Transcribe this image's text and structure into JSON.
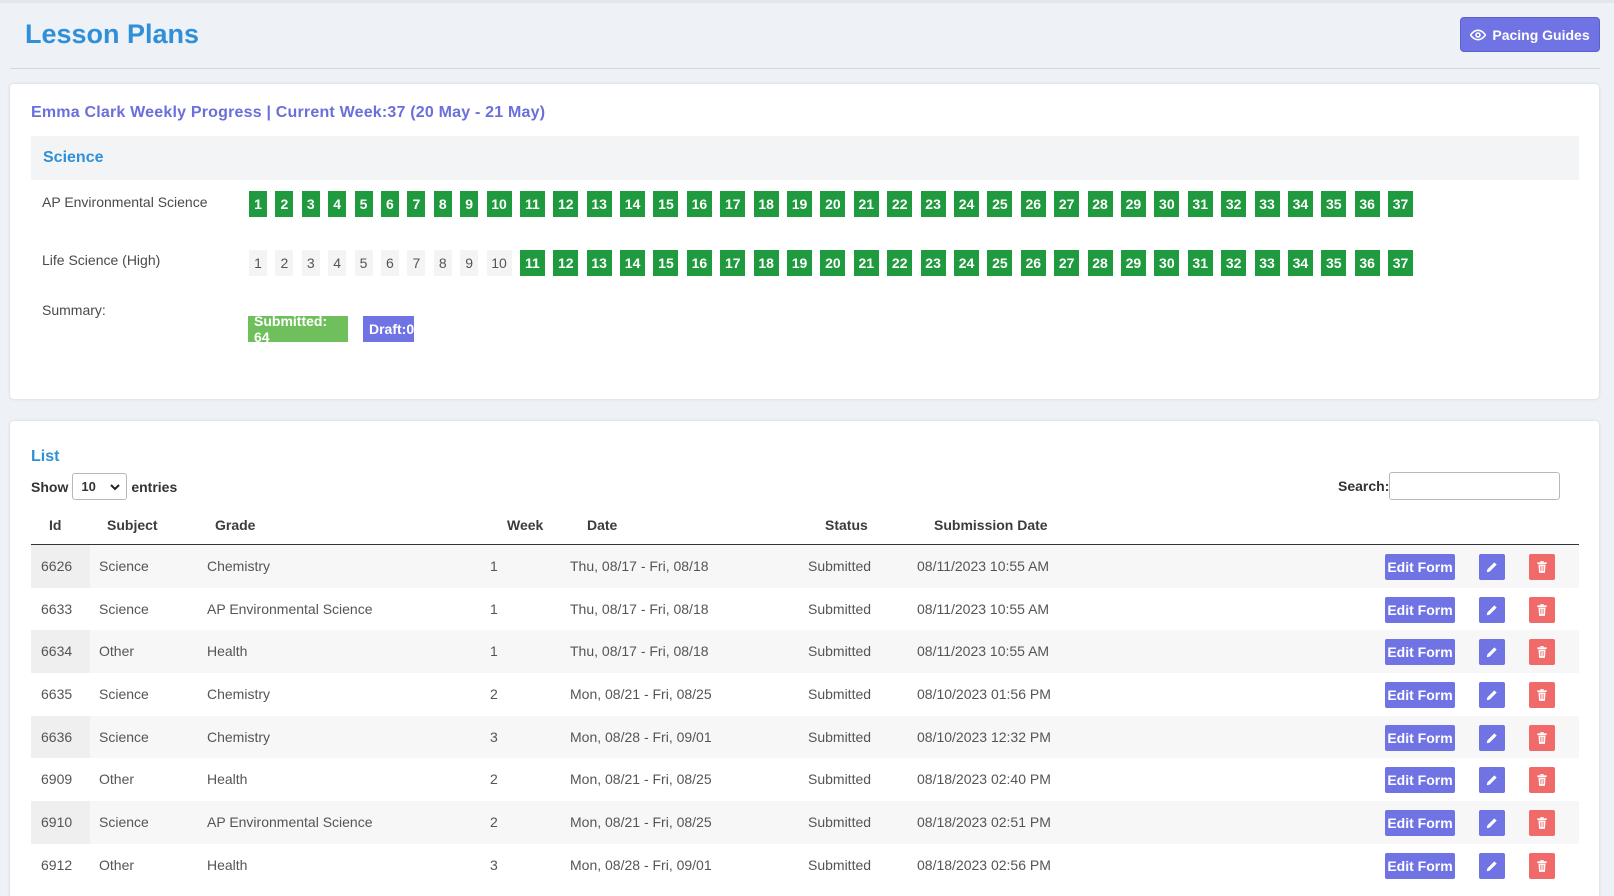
{
  "header": {
    "title": "Lesson Plans",
    "pacing_button": "Pacing Guides"
  },
  "progress": {
    "title": "Emma Clark Weekly Progress | Current Week:37 (20 May - 21 May)",
    "section": "Science",
    "rows": [
      {
        "label": "AP Environmental Science",
        "weeks": [
          "1",
          "2",
          "3",
          "4",
          "5",
          "6",
          "7",
          "8",
          "9",
          "10",
          "11",
          "12",
          "13",
          "14",
          "15",
          "16",
          "17",
          "18",
          "19",
          "20",
          "21",
          "22",
          "23",
          "24",
          "25",
          "26",
          "27",
          "28",
          "29",
          "30",
          "31",
          "32",
          "33",
          "34",
          "35",
          "36",
          "37"
        ],
        "submitted_from": 1
      },
      {
        "label": "Life Science (High)",
        "weeks": [
          "1",
          "2",
          "3",
          "4",
          "5",
          "6",
          "7",
          "8",
          "9",
          "10",
          "11",
          "12",
          "13",
          "14",
          "15",
          "16",
          "17",
          "18",
          "19",
          "20",
          "21",
          "22",
          "23",
          "24",
          "25",
          "26",
          "27",
          "28",
          "29",
          "30",
          "31",
          "32",
          "33",
          "34",
          "35",
          "36",
          "37"
        ],
        "submitted_from": 11
      }
    ],
    "summary_label": "Summary:",
    "submitted_badge": "Submitted: 64",
    "draft_badge": "Draft:0",
    "colors": {
      "submitted": "#1f9a3e",
      "summary_submitted": "#6fc05d",
      "draft": "#6f73e4"
    }
  },
  "list": {
    "title": "List",
    "show_label": "Show",
    "entries_value": "10",
    "entries_label": "entries",
    "search_label": "Search:",
    "search_value": "",
    "columns": [
      "Id",
      "Subject",
      "Grade",
      "Week",
      "Date",
      "Status",
      "Submission Date"
    ],
    "edit_form_label": "Edit Form",
    "rows": [
      {
        "id": "6626",
        "subject": "Science",
        "grade": "Chemistry",
        "week": "1",
        "date": "Thu, 08/17 - Fri, 08/18",
        "status": "Submitted",
        "submission": "08/11/2023 10:55 AM"
      },
      {
        "id": "6633",
        "subject": "Science",
        "grade": "AP Environmental Science",
        "week": "1",
        "date": "Thu, 08/17 - Fri, 08/18",
        "status": "Submitted",
        "submission": "08/11/2023 10:55 AM"
      },
      {
        "id": "6634",
        "subject": "Other",
        "grade": "Health",
        "week": "1",
        "date": "Thu, 08/17 - Fri, 08/18",
        "status": "Submitted",
        "submission": "08/11/2023 10:55 AM"
      },
      {
        "id": "6635",
        "subject": "Science",
        "grade": "Chemistry",
        "week": "2",
        "date": "Mon, 08/21 - Fri, 08/25",
        "status": "Submitted",
        "submission": "08/10/2023 01:56 PM"
      },
      {
        "id": "6636",
        "subject": "Science",
        "grade": "Chemistry",
        "week": "3",
        "date": "Mon, 08/28 - Fri, 09/01",
        "status": "Submitted",
        "submission": "08/10/2023 12:32 PM"
      },
      {
        "id": "6909",
        "subject": "Other",
        "grade": "Health",
        "week": "2",
        "date": "Mon, 08/21 - Fri, 08/25",
        "status": "Submitted",
        "submission": "08/18/2023 02:40 PM"
      },
      {
        "id": "6910",
        "subject": "Science",
        "grade": "AP Environmental Science",
        "week": "2",
        "date": "Mon, 08/21 - Fri, 08/25",
        "status": "Submitted",
        "submission": "08/18/2023 02:51 PM"
      },
      {
        "id": "6912",
        "subject": "Other",
        "grade": "Health",
        "week": "3",
        "date": "Mon, 08/28 - Fri, 09/01",
        "status": "Submitted",
        "submission": "08/18/2023 02:56 PM"
      }
    ]
  }
}
